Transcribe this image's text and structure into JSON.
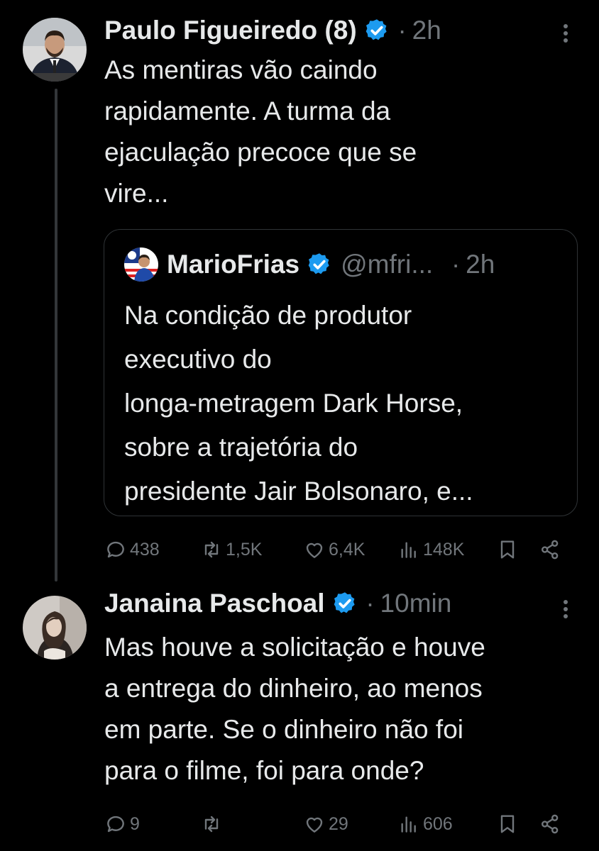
{
  "tweets": [
    {
      "author": "Paulo Figueiredo (8)",
      "time": "2h",
      "text_lines": [
        "As mentiras vão caindo",
        "rapidamente. A turma da",
        "ejaculação precoce que se",
        "vire..."
      ],
      "quote": {
        "author": "MarioFrias",
        "handle": "@mfri...",
        "time": "2h",
        "text_lines": [
          "Na condição de produtor",
          "executivo do",
          "longa-metragem Dark Horse,",
          "sobre a trajetória do",
          "presidente Jair Bolsonaro, e..."
        ]
      },
      "stats": {
        "replies": "438",
        "retweets": "1,5K",
        "likes": "6,4K",
        "views": "148K"
      }
    },
    {
      "author": "Janaina Paschoal",
      "time": "10min",
      "text_lines": [
        "Mas houve a solicitação e houve",
        "a entrega do dinheiro, ao menos",
        "em parte. Se o dinheiro não foi",
        "para o filme, foi para onde?"
      ],
      "stats": {
        "replies": "9",
        "retweets": "",
        "likes": "29",
        "views": "606"
      }
    }
  ],
  "separator": "·",
  "colors": {
    "background": "#000000",
    "text": "#e7e9ea",
    "muted": "#71767b",
    "verified": "#1d9bf0",
    "border": "#2f3336"
  },
  "icons": [
    "verified-badge-icon",
    "more-icon",
    "reply-icon",
    "retweet-icon",
    "like-icon",
    "views-icon",
    "bookmark-icon",
    "share-icon"
  ]
}
